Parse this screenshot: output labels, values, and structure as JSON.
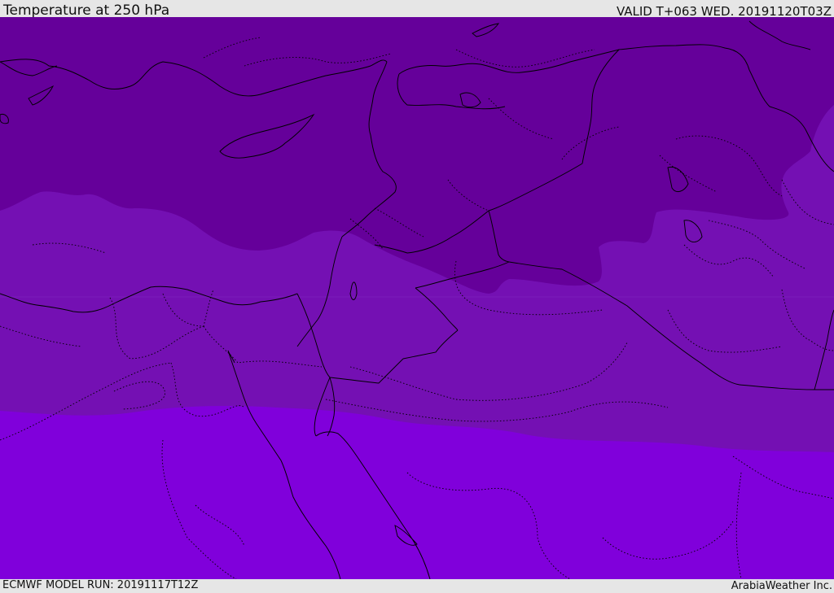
{
  "header": {
    "title": "Temperature at 250 hPa",
    "valid": "VALID T+063 WED. 20191120T03Z"
  },
  "footer": {
    "model_run": "ECMWF MODEL RUN: 20191117T12Z",
    "credit": "ArabiaWeather Inc."
  },
  "map": {
    "bands": [
      {
        "name": "coldest",
        "color": "#65009a"
      },
      {
        "name": "middle",
        "color": "#7410b3"
      },
      {
        "name": "warmest",
        "color": "#8000db"
      }
    ],
    "coastline_color": "#000000",
    "border_style": "dotted"
  }
}
